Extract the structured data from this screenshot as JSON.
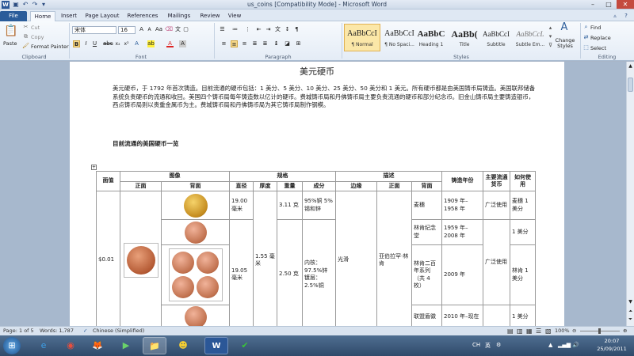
{
  "window": {
    "title": "us_coins [Compatibility Mode] - Microsoft Word",
    "min": "–",
    "max": "□",
    "close": "✕"
  },
  "tabs": [
    "File",
    "Home",
    "Insert",
    "Page Layout",
    "References",
    "Mailings",
    "Review",
    "View"
  ],
  "clipboard": {
    "paste": "Paste",
    "cut": "Cut",
    "copy": "Copy",
    "format_painter": "Format Painter",
    "label": "Clipboard"
  },
  "font": {
    "name": "宋体",
    "size": "16",
    "label": "Font",
    "bold": "B",
    "italic": "I",
    "underline": "U"
  },
  "paragraph": {
    "label": "Paragraph"
  },
  "styles": {
    "label": "Styles",
    "items": [
      {
        "preview": "AaBbCcI",
        "name": "¶ Normal"
      },
      {
        "preview": "AaBbCcI",
        "name": "¶ No Spaci..."
      },
      {
        "preview": "AaBbC",
        "name": "Heading 1"
      },
      {
        "preview": "AaBb(",
        "name": "Title"
      },
      {
        "preview": "AaBbCcI",
        "name": "Subtitle"
      },
      {
        "preview": "AaBbCcL",
        "name": "Subtle Em..."
      }
    ],
    "change": "Change Styles"
  },
  "editing": {
    "find": "Find",
    "replace": "Replace",
    "select": "Select",
    "label": "Editing"
  },
  "document": {
    "title": "美元硬币",
    "body": "美元硬币，于 1792 年首次铸造。目前流通的硬币包括：1 美分、5 美分、10 美分、25 美分、50 美分和 1 美元。所有硬币都是由美国铸币局铸造。美国联邦储备系统负责硬币的流通和收回。美国四个铸币局每年铸造数以亿计的硬币。费城铸币局和丹佛铸币局主要负责流通的硬币和部分纪念币。旧金山铸币局主要铸造银币，西点铸币局则以贵重金属币为主。费城铸币局和丹佛铸币局为其它铸币局制作钢模。",
    "heading": "目前流通的美国硬币一览"
  },
  "table": {
    "h_value": "面值",
    "h_image": "图像",
    "h_spec": "规格",
    "h_desc": "描述",
    "h_year": "铸造年份",
    "h_currency": "主要流通货币",
    "h_usage": "如何使用",
    "h_front": "正面",
    "h_back": "背面",
    "h_diameter": "直径",
    "h_thickness": "厚度",
    "h_weight": "重量",
    "h_composition": "成分",
    "h_edge": "边缘",
    "h_front2": "正面",
    "h_back2": "背面",
    "value": "$0.01",
    "thickness": "1.55 毫米",
    "edge": "光滑",
    "obverse": "亚伯拉罕·林肯",
    "rows": [
      {
        "diameter": "19.00 毫米",
        "weight": "3.11 克",
        "composition": "95%铜 5%锡和锌",
        "reverse": "麦穗",
        "year": "1909 年–1958 年",
        "currency": "广泛使用",
        "usage": "麦穗 1 美分"
      },
      {
        "reverse": "林肯纪念堂",
        "year": "1959 年–2008 年",
        "usage": "1 美分"
      },
      {
        "diameter": "19.05 毫米",
        "weight": "2.50 克",
        "composition": "内核：97.5%锌 镀层：2.5%铜",
        "reverse": "林肯二百年系列（共 4 枚）",
        "year": "2009 年",
        "currency": "广泛使用",
        "usage": "林肯 1 美分"
      },
      {
        "reverse": "联盟盾徽",
        "year": "2010 年–现在",
        "usage": "1 美分"
      }
    ]
  },
  "status": {
    "page": "Page: 1 of 5",
    "words": "Words: 1,787",
    "language": "Chinese (Simplified)",
    "zoom": "100%"
  },
  "taskbar": {
    "lang": "CH",
    "ime": "英",
    "time": "20:07",
    "date": "25/09/2011"
  }
}
